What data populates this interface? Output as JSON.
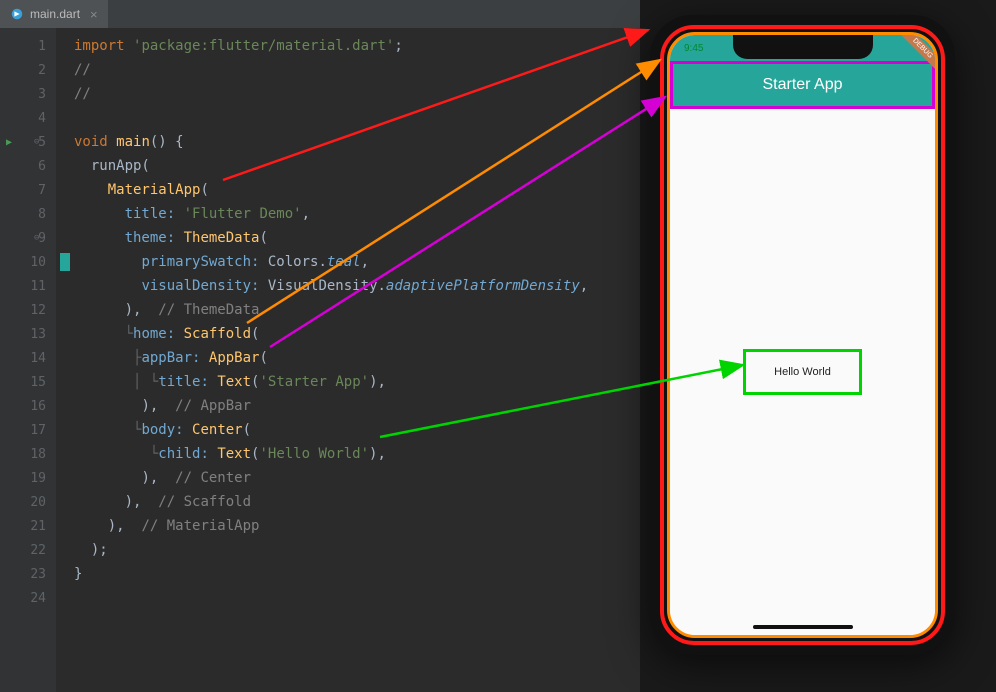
{
  "tab": {
    "filename": "main.dart",
    "close": "×"
  },
  "gutter": {
    "lines": [
      "1",
      "2",
      "3",
      "4",
      "5",
      "6",
      "7",
      "8",
      "9",
      "10",
      "11",
      "12",
      "13",
      "14",
      "15",
      "16",
      "17",
      "18",
      "19",
      "20",
      "21",
      "22",
      "23",
      "24"
    ]
  },
  "code": {
    "l1": {
      "kw": "import ",
      "str": "'package:flutter/material.dart'",
      "end": ";"
    },
    "l2": "//",
    "l3": "//",
    "l5": {
      "kw1": "void ",
      "fn": "main",
      "rest": "() {"
    },
    "l6": "runApp(",
    "l7": {
      "cls": "MaterialApp",
      "rest": "("
    },
    "l8": {
      "param": "title: ",
      "str": "'Flutter Demo'",
      "end": ","
    },
    "l9": {
      "param": "theme: ",
      "cls": "ThemeData",
      "rest": "("
    },
    "l10": {
      "param": "primarySwatch: ",
      "val": "Colors.",
      "ital": "teal",
      "end": ","
    },
    "l11": {
      "param": "visualDensity: ",
      "val": "VisualDensity.",
      "ital": "adaptivePlatformDensity",
      "end": ","
    },
    "l12": {
      "close": "),  ",
      "cmt": "// ThemeData"
    },
    "l13": {
      "param": "home: ",
      "cls": "Scaffold",
      "rest": "("
    },
    "l14": {
      "param": "appBar: ",
      "cls": "AppBar",
      "rest": "("
    },
    "l15": {
      "param": "title: ",
      "cls": "Text",
      "open": "(",
      "str": "'Starter App'",
      "end": "),"
    },
    "l16": {
      "close": "),  ",
      "cmt": "// AppBar"
    },
    "l17": {
      "param": "body: ",
      "cls": "Center",
      "rest": "("
    },
    "l18": {
      "param": "child: ",
      "cls": "Text",
      "open": "(",
      "str": "'Hello World'",
      "end": "),"
    },
    "l19": {
      "close": "),  ",
      "cmt": "// Center"
    },
    "l20": {
      "close": "),  ",
      "cmt": "// Scaffold"
    },
    "l21": {
      "close": "),  ",
      "cmt": "// MaterialApp"
    },
    "l22": ");",
    "l23": "}"
  },
  "phone": {
    "status_time": "9:45",
    "appbar_title": "Starter App",
    "body_text": "Hello World",
    "debug": "DEBUG"
  },
  "colors": {
    "red": "#ff1a1a",
    "orange": "#ff8c00",
    "magenta": "#d400d4",
    "green": "#00d400",
    "teal": "#26a69a"
  }
}
